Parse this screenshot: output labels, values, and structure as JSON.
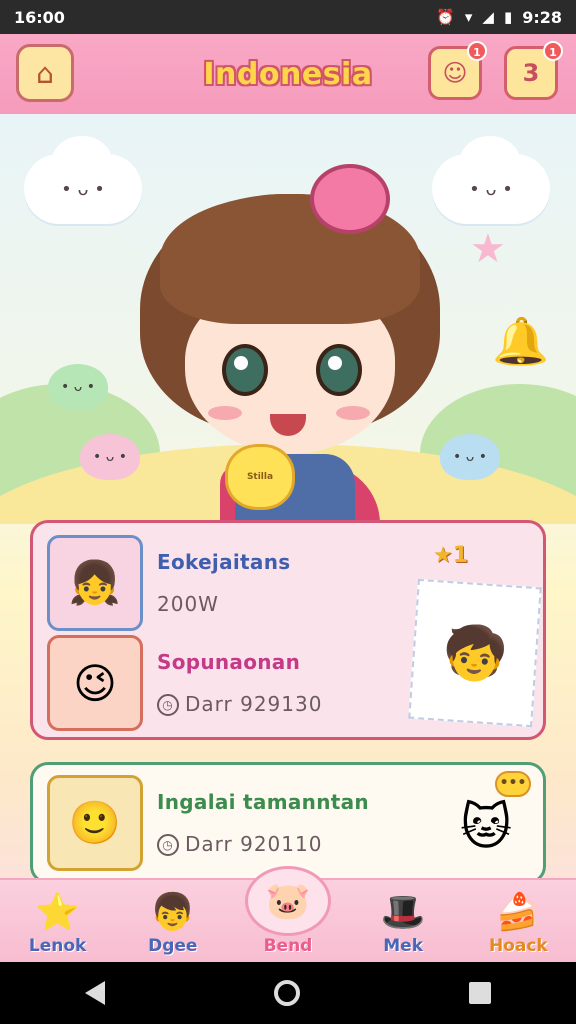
{
  "status_bar": {
    "time_left": "16:00",
    "time_right": "9:28",
    "icons": [
      "alarm-icon",
      "wifi-icon",
      "signal-icon",
      "battery-icon"
    ]
  },
  "header": {
    "title": "Indonesia",
    "home_icon": "house-star-icon",
    "button_1_icon": "face-icon",
    "button_2_label": "3",
    "badge_1": "1",
    "badge_2": "1"
  },
  "hero": {
    "plush_text": "Stilla"
  },
  "card1": {
    "rank_label": "★1",
    "rows": [
      {
        "name": "Eokejaitans",
        "meta": "200W"
      },
      {
        "name": "Sopunaonan",
        "meta": "Darr 929130"
      }
    ]
  },
  "card2": {
    "rows": [
      {
        "name": "Ingalai tamanntan",
        "meta": "Darr 920110"
      }
    ],
    "bubble_text": "•••"
  },
  "bottom_nav": {
    "items": [
      {
        "label": "Lenok",
        "icon": "star-icon"
      },
      {
        "label": "Dgee",
        "icon": "character-icon"
      },
      {
        "label": "Bend",
        "icon": "pig-icon"
      },
      {
        "label": "Mek",
        "icon": "hat-icon"
      },
      {
        "label": "Hoack",
        "icon": "cake-icon"
      }
    ],
    "active_index": 2
  },
  "colors": {
    "header_pink": "#f59bbb",
    "title_yellow": "#ffd64a",
    "card1_border": "#d25675",
    "card2_border": "#4f9e75",
    "nav_active": "#ea5c8c"
  }
}
